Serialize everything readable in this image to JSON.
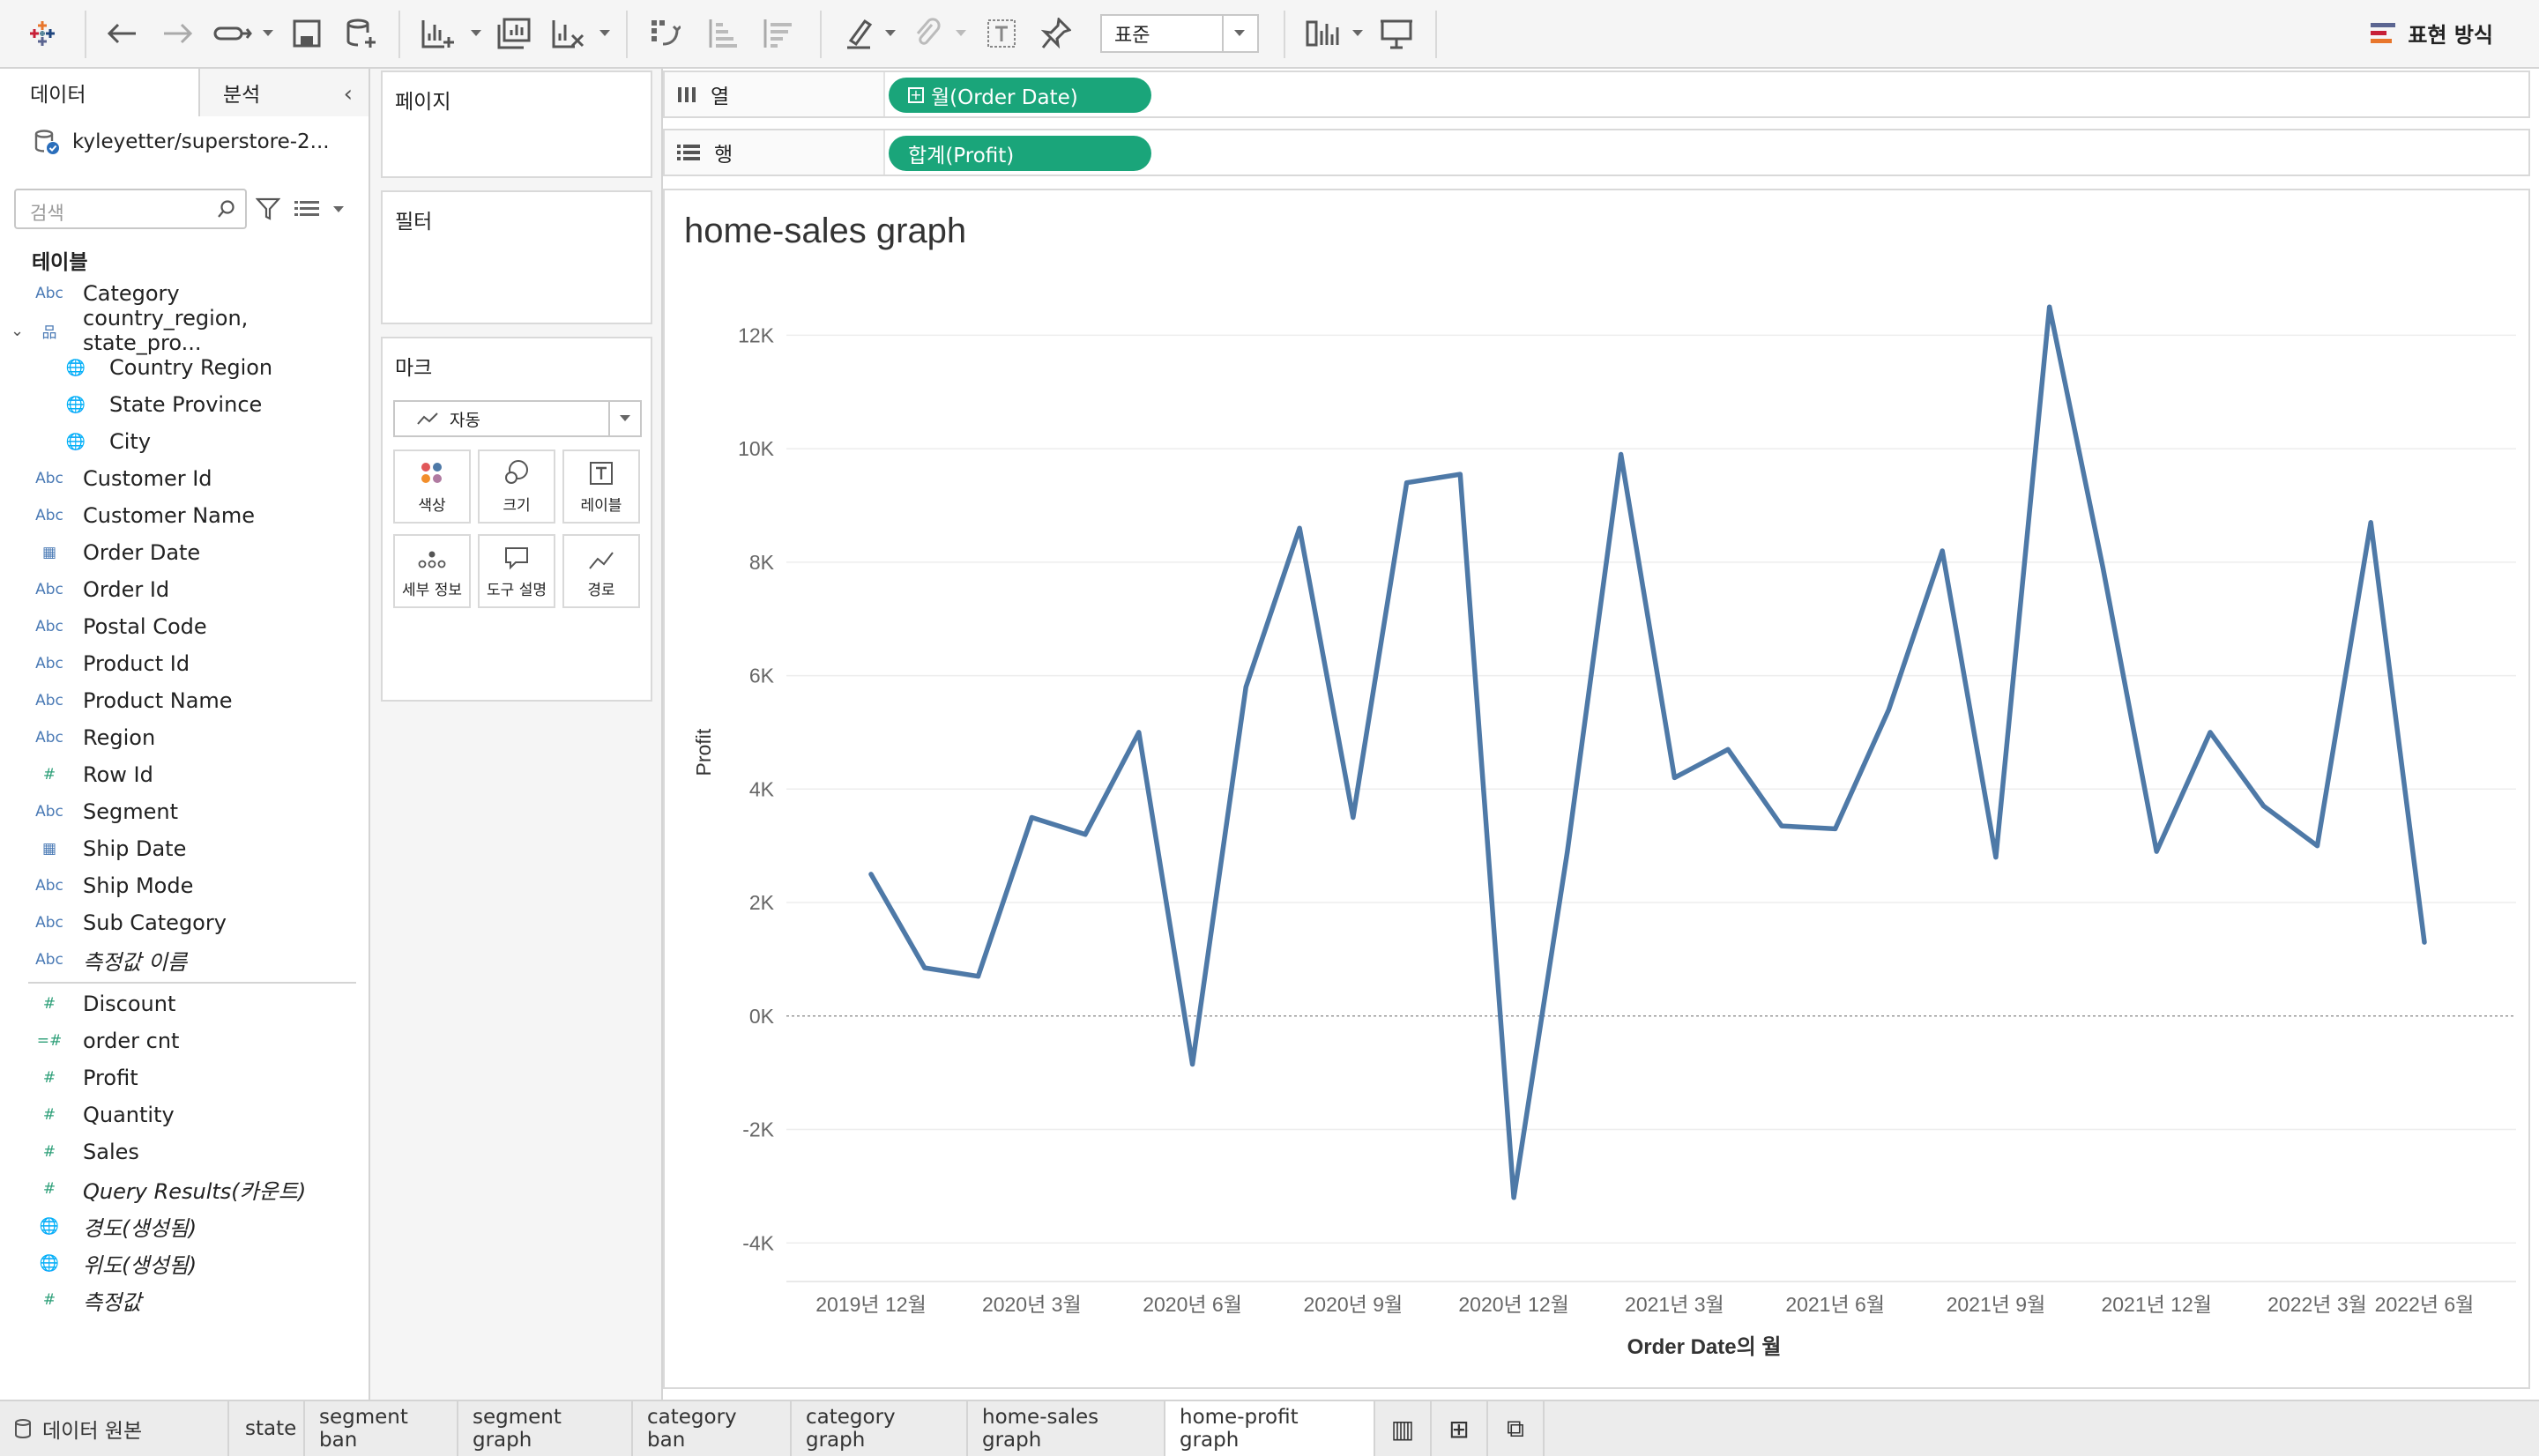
{
  "toolbar": {
    "fit_label": "표준",
    "show_me_label": "표현 방식"
  },
  "left_panel": {
    "tab_data": "데이터",
    "tab_analysis": "분석",
    "source_name": "kyleyetter/superstore-2...",
    "search_placeholder": "검색",
    "tables_header": "테이블",
    "fields": [
      {
        "type": "Abc",
        "label": "Category"
      },
      {
        "type": "hier",
        "label": "country_region, state_pro..."
      },
      {
        "type": "geo",
        "label": "Country Region",
        "child": true
      },
      {
        "type": "geo",
        "label": "State Province",
        "child": true
      },
      {
        "type": "geo",
        "label": "City",
        "child": true
      },
      {
        "type": "Abc",
        "label": "Customer Id"
      },
      {
        "type": "Abc",
        "label": "Customer Name"
      },
      {
        "type": "date",
        "label": "Order Date"
      },
      {
        "type": "Abc",
        "label": "Order Id"
      },
      {
        "type": "Abc",
        "label": "Postal Code"
      },
      {
        "type": "Abc",
        "label": "Product Id"
      },
      {
        "type": "Abc",
        "label": "Product Name"
      },
      {
        "type": "Abc",
        "label": "Region"
      },
      {
        "type": "num",
        "label": "Row Id"
      },
      {
        "type": "Abc",
        "label": "Segment"
      },
      {
        "type": "date",
        "label": "Ship Date"
      },
      {
        "type": "Abc",
        "label": "Ship Mode"
      },
      {
        "type": "Abc",
        "label": "Sub Category"
      },
      {
        "type": "Abc",
        "label": "측정값 이름",
        "italic": true
      }
    ],
    "measures": [
      {
        "type": "num",
        "label": "Discount"
      },
      {
        "type": "calc",
        "label": "order cnt"
      },
      {
        "type": "num",
        "label": "Profit"
      },
      {
        "type": "num",
        "label": "Quantity"
      },
      {
        "type": "num",
        "label": "Sales"
      },
      {
        "type": "num",
        "label": "Query Results(카운트)",
        "italic": true
      },
      {
        "type": "geo",
        "label": "경도(생성됨)",
        "italic": true
      },
      {
        "type": "geo",
        "label": "위도(생성됨)",
        "italic": true
      },
      {
        "type": "num",
        "label": "측정값",
        "italic": true
      }
    ]
  },
  "cards": {
    "pages": "페이지",
    "filters": "필터",
    "marks": "마크",
    "mark_type": "자동",
    "buttons": [
      "색상",
      "크기",
      "레이블",
      "세부 정보",
      "도구 설명",
      "경로"
    ]
  },
  "shelves": {
    "columns_label": "열",
    "rows_label": "행",
    "columns_pill": "월(Order Date)",
    "rows_pill": "합계(Profit)"
  },
  "viz": {
    "title": "home-sales graph",
    "line_color": "#4e79a7"
  },
  "chart_data": {
    "type": "line",
    "xlabel": "Order Date의 월",
    "ylabel": "Profit",
    "ylim": [
      -4400,
      13000
    ],
    "y_ticks": [
      "-4K",
      "-2K",
      "0K",
      "2K",
      "4K",
      "6K",
      "8K",
      "10K",
      "12K"
    ],
    "y_tick_values": [
      -4000,
      -2000,
      0,
      2000,
      4000,
      6000,
      8000,
      10000,
      12000
    ],
    "x_ticks": [
      "2019년 12월",
      "2020년 3월",
      "2020년 6월",
      "2020년 9월",
      "2020년 12월",
      "2021년 3월",
      "2021년 6월",
      "2021년 9월",
      "2021년 12월",
      "2022년 3월",
      "2022년 6월"
    ],
    "x": [
      "2019-12",
      "2020-01",
      "2020-02",
      "2020-03",
      "2020-04",
      "2020-05",
      "2020-06",
      "2020-07",
      "2020-08",
      "2020-09",
      "2020-10",
      "2020-11",
      "2020-12",
      "2021-01",
      "2021-02",
      "2021-03",
      "2021-04",
      "2021-05",
      "2021-06",
      "2021-07",
      "2021-08",
      "2021-09",
      "2021-10",
      "2021-11",
      "2021-12",
      "2022-01",
      "2022-02",
      "2022-03",
      "2022-04",
      "2022-05",
      "2022-06"
    ],
    "series": [
      {
        "values": [
          2500,
          850,
          700,
          3500,
          3200,
          5000,
          -850,
          5800,
          8600,
          3500,
          9400,
          9550,
          -3200,
          2900,
          9900,
          4200,
          4700,
          3350,
          3300,
          5400,
          8200,
          2800,
          12500,
          7900,
          2900,
          5000,
          3700,
          3000,
          8700,
          1300
        ]
      }
    ],
    "grid": "horizontal",
    "zero_line": true
  },
  "sheet_tabs": {
    "data_source": "데이터 원본",
    "sheets": [
      "state",
      "segment ban",
      "segment graph",
      "category ban",
      "category graph",
      "home-sales graph",
      "home-profit graph"
    ],
    "active": "home-profit graph"
  }
}
